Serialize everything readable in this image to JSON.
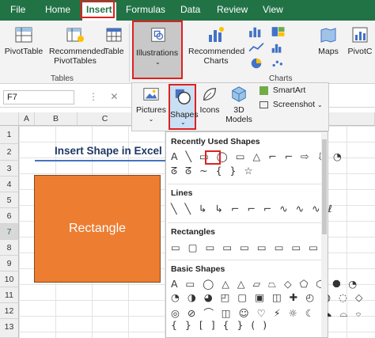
{
  "menu": {
    "tabs": [
      "File",
      "Home",
      "Insert",
      "Formulas",
      "Data",
      "Review",
      "View"
    ],
    "active": "Insert"
  },
  "ribbon": {
    "pivottable": "PivotTable",
    "recommended_pivot": "Recommended PivotTables",
    "recommended_pivot_l1": "Recommended",
    "recommended_pivot_l2": "PivotTables",
    "table": "Table",
    "illustrations": "Illustrations",
    "recommended_charts_l1": "Recommended",
    "recommended_charts_l2": "Charts",
    "maps": "Maps",
    "pivotchart": "PivotC",
    "group_tables": "Tables",
    "group_charts": "Charts"
  },
  "illustrations_menu": {
    "pictures": "Pictures",
    "shapes": "Shapes",
    "icons": "Icons",
    "models_l1": "3D",
    "models_l2": "Models",
    "smartart": "SmartArt",
    "screenshot": "Screenshot"
  },
  "formula_bar": {
    "name_box": "F7",
    "icons": "⋮ ✕ ✓ fx"
  },
  "grid": {
    "columns": [
      "A",
      "B",
      "C"
    ],
    "rows": [
      "1",
      "2",
      "3",
      "4",
      "5",
      "6",
      "7",
      "8",
      "9",
      "10",
      "11",
      "12",
      "13"
    ]
  },
  "sheet": {
    "title": "Insert Shape in Excel",
    "shape_label": "Rectangle"
  },
  "gallery": {
    "recently_used": "Recently Used Shapes",
    "lines": "Lines",
    "rectangles": "Rectangles",
    "basic_shapes": "Basic Shapes",
    "recent_row1": "A ╲ ▭ ◯ ▭ △ ⌐ ⌐ ⇨ ⇩ ◔",
    "recent_row2": "ᘔ ᘔ ~ { } ☆",
    "lines_row": "╲ ╲ ↳ ↳ ⌐ ⌐ ⌐ ∿ ∿ ∿ ℓ",
    "rect_row": "▭ ▢ ▭ ▭ ▭ ▭ ▭ ▭ ▭",
    "basic_row1": "A ▭ ◯ △ △ ▱ ⏢ ◇ ⬠ ⬡ ⯃ ◔",
    "basic_row2": "◔ ◑ ◕ ◰ ▢ ▣ ◫ ✚ ◴ ◍ ◌ ◇",
    "basic_row3": "◎ ⊘ ⌒ ◫ ☺ ♡ ⚡ ☼ ☾ ☁ ⌓ ⌔",
    "basic_row4": "{ } [ ] { } ( )"
  },
  "colors": {
    "excel_green": "#217346",
    "shape_fill": "#ed7d31",
    "highlight": "#e02020",
    "title_blue": "#1f3864"
  }
}
